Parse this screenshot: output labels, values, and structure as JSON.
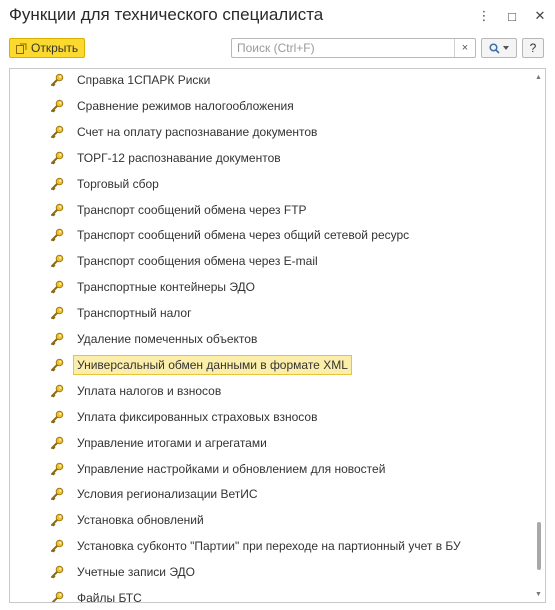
{
  "window": {
    "title": "Функции для технического специалиста",
    "menu_glyph": "⋮",
    "maximize_glyph": "□",
    "close_glyph": "✕"
  },
  "toolbar": {
    "open_label": "Открыть",
    "search_placeholder": "Поиск (Ctrl+F)",
    "search_value": "",
    "clear_glyph": "×",
    "help_label": "?"
  },
  "list": {
    "items": [
      {
        "label": "Справка 1СПАРК Риски"
      },
      {
        "label": "Сравнение режимов налогообложения"
      },
      {
        "label": "Счет на оплату распознавание документов"
      },
      {
        "label": "ТОРГ-12 распознавание документов"
      },
      {
        "label": "Торговый сбор"
      },
      {
        "label": "Транспорт сообщений обмена через FTP"
      },
      {
        "label": "Транспорт сообщений обмена через общий сетевой ресурс"
      },
      {
        "label": "Транспорт сообщения обмена через E-mail"
      },
      {
        "label": "Транспортные контейнеры ЭДО"
      },
      {
        "label": "Транспортный налог"
      },
      {
        "label": "Удаление помеченных объектов"
      },
      {
        "label": "Универсальный обмен данными в формате XML",
        "selected": true
      },
      {
        "label": "Уплата налогов и взносов"
      },
      {
        "label": "Уплата фиксированных страховых взносов"
      },
      {
        "label": "Управление итогами и агрегатами"
      },
      {
        "label": "Управление настройками и обновлением для новостей"
      },
      {
        "label": "Условия регионализации ВетИС"
      },
      {
        "label": "Установка обновлений"
      },
      {
        "label": "Установка субконто \"Партии\" при переходе на партионный учет в БУ"
      },
      {
        "label": "Учетные записи ЭДО"
      },
      {
        "label": "Файлы БТС"
      }
    ]
  },
  "colors": {
    "accent_button": "#fcd92f",
    "selection_bg": "#fbeeaa",
    "selection_border": "#e8c43a"
  },
  "icons": {
    "item_icon": "key-icon",
    "open_icon": "open-form-icon",
    "search_icon": "search-icon"
  }
}
